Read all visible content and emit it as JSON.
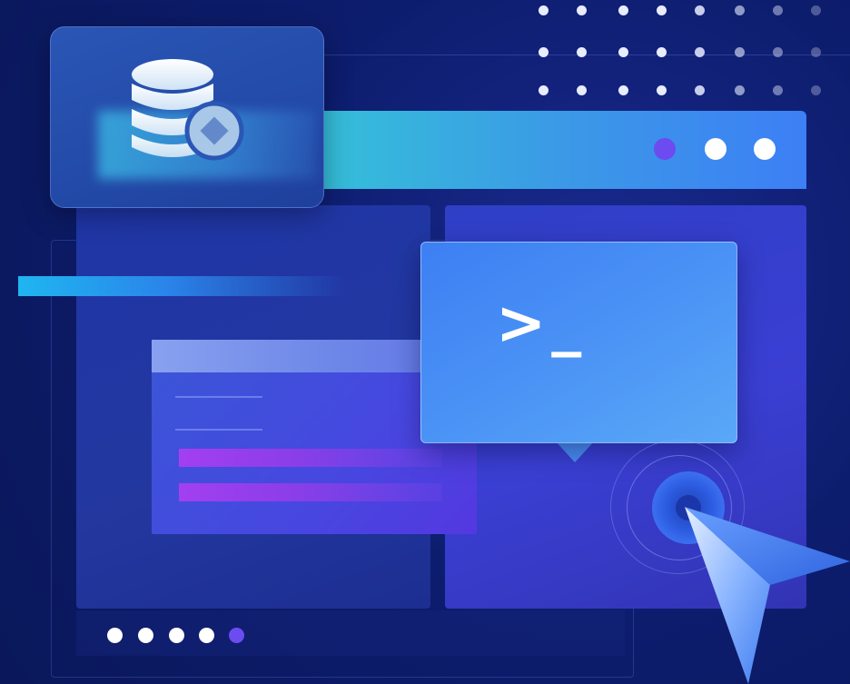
{
  "terminal": {
    "prompt": ">_"
  },
  "icons": {
    "database": "database-icon",
    "cursor": "cursor-arrow-icon",
    "terminal": "terminal-prompt-icon"
  },
  "colors": {
    "background": "#0b1a63",
    "window_bar_start": "#35c1d8",
    "window_bar_end": "#3d7ff5",
    "accent_purple": "#6c4cf0",
    "dot_white": "#ffffff",
    "terminal_blue": "#4a92f5",
    "doc_bar_magenta": "#a33ff0"
  }
}
